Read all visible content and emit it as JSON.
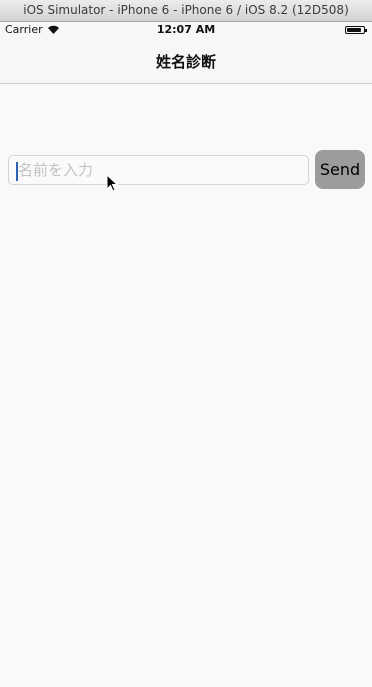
{
  "simulator": {
    "title": "iOS Simulator - iPhone 6 - iPhone 6 / iOS 8.2 (12D508)"
  },
  "status_bar": {
    "carrier": "Carrier",
    "time": "12:07 AM",
    "battery_level": 0.9
  },
  "nav_bar": {
    "title": "姓名診断"
  },
  "form": {
    "name_input": {
      "placeholder": "名前を入力",
      "value": ""
    },
    "send_label": "Send"
  },
  "colors": {
    "button_bg": "#9b9b9b",
    "caret": "#2f62b5"
  },
  "icons": {
    "wifi": "wifi-icon",
    "battery": "battery-icon",
    "cursor": "mouse-pointer-icon"
  }
}
